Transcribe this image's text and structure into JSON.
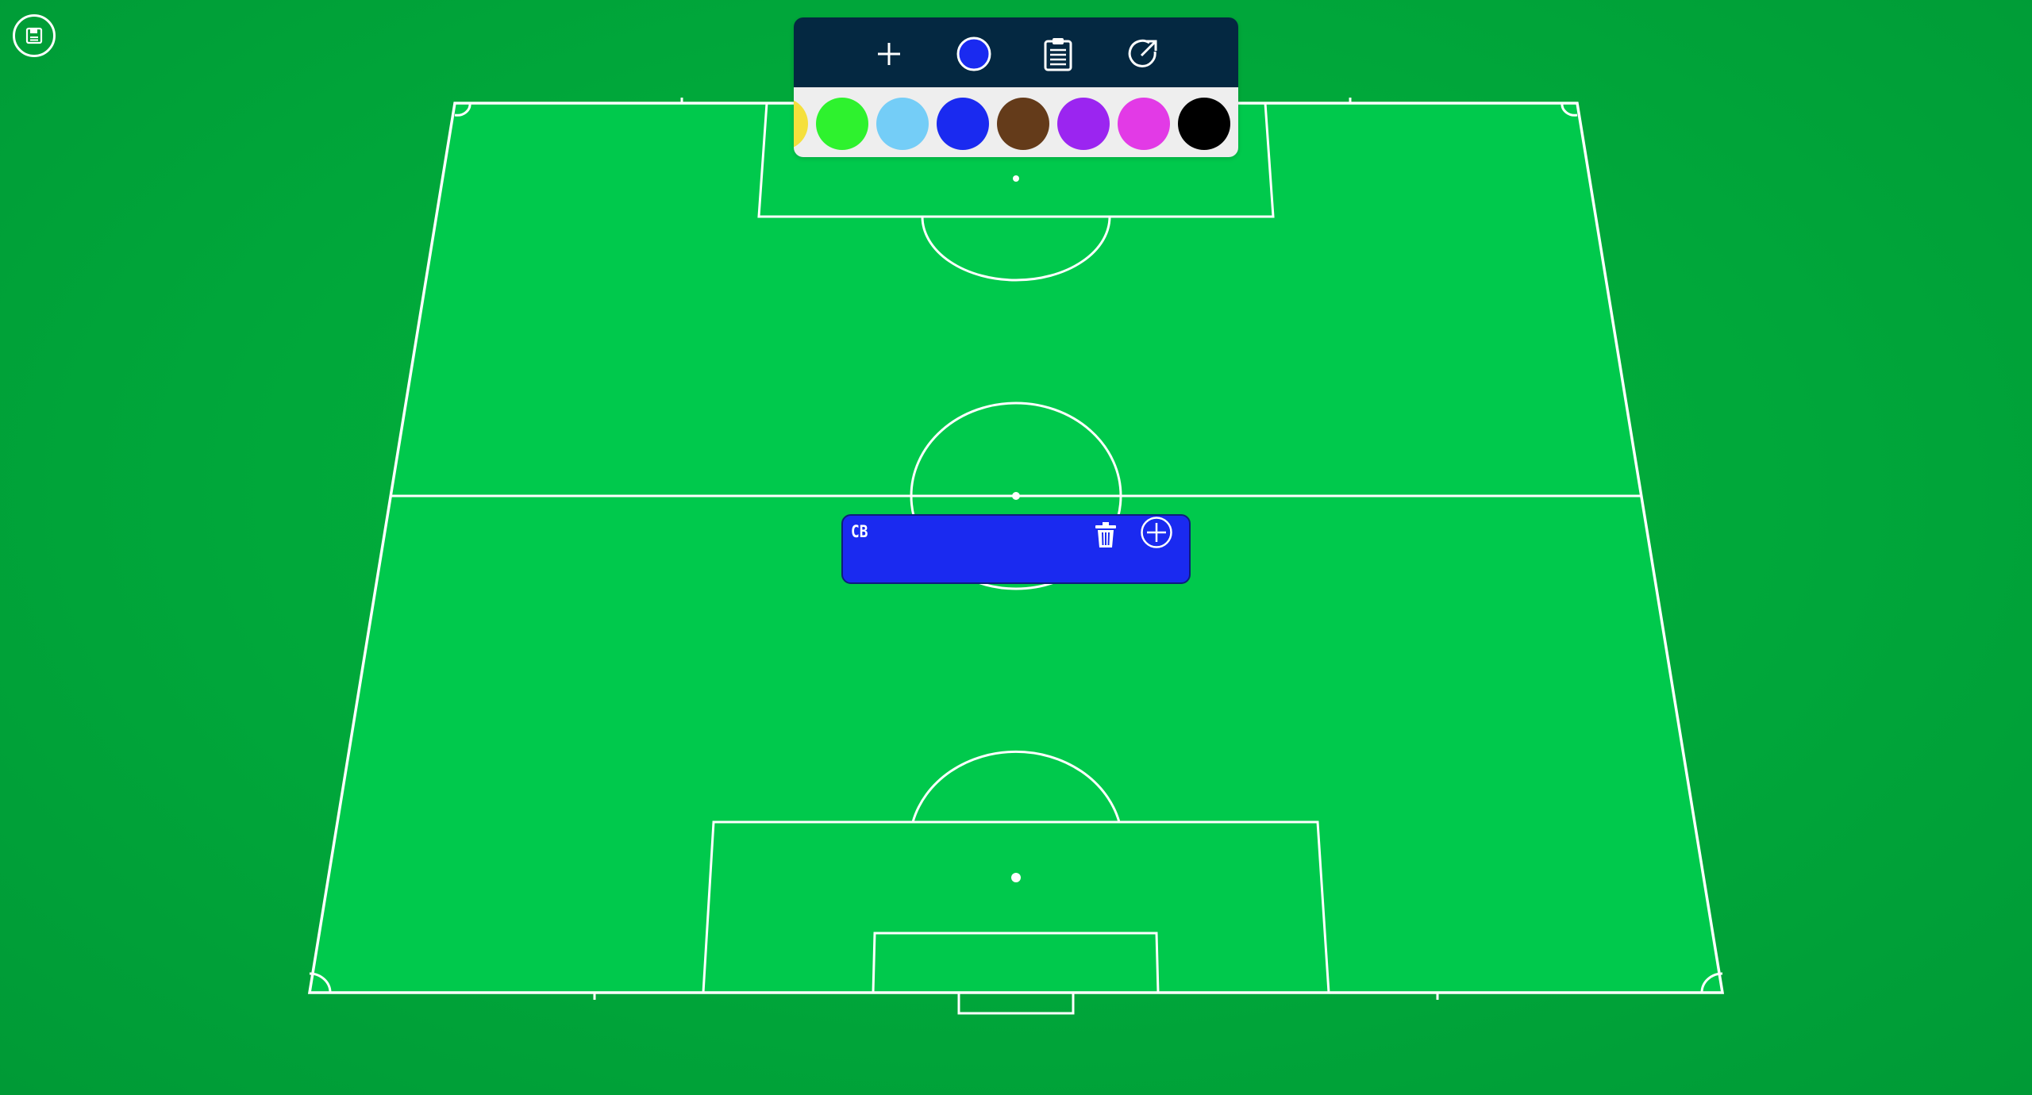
{
  "colors": {
    "pitch": "#00c94c",
    "lines": "#ffffff",
    "toolbar_dark": "#042841",
    "toolbar_light": "#eeeeee",
    "selected_color": "#1a2af0"
  },
  "save_button": {
    "icon": "save-icon"
  },
  "toolbar": {
    "tools": [
      {
        "name": "add-icon"
      },
      {
        "name": "color-picker-icon"
      },
      {
        "name": "clipboard-icon"
      },
      {
        "name": "export-icon"
      }
    ],
    "swatches": [
      "#f5e03c",
      "#2ef22e",
      "#74cdf7",
      "#1a2af0",
      "#643b1a",
      "#9b25f0",
      "#e23ae6",
      "#000000"
    ]
  },
  "player": {
    "label": "CB",
    "color": "#1a2af0"
  }
}
